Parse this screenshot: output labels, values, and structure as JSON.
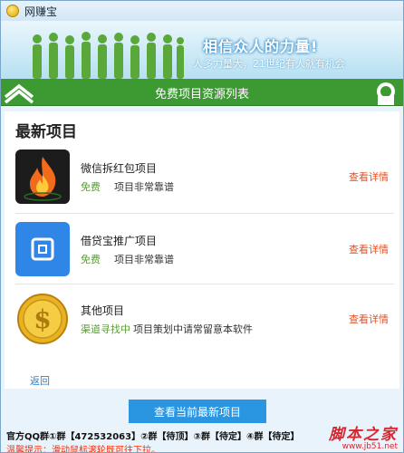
{
  "window": {
    "title": "网赚宝"
  },
  "banner": {
    "slogan": "相信众人的力量!",
    "subslogan": "人多力量大，21世纪有人就有机会"
  },
  "nav": {
    "title": "免费项目资源列表"
  },
  "section": {
    "title": "最新项目"
  },
  "items": [
    {
      "name": "微信拆红包项目",
      "tag": "免费",
      "desc": "项目非常靠谱",
      "link": "查看详情",
      "icon": "flame-icon"
    },
    {
      "name": "借贷宝推广项目",
      "tag": "免费",
      "desc": "项目非常靠谱",
      "link": "查看详情",
      "icon": "jiedaibao-icon"
    },
    {
      "name": "其他项目",
      "tag": "渠道寻找中",
      "desc": "项目策划中请常留意本软件",
      "link": "查看详情",
      "icon": "dollar-coin-icon"
    }
  ],
  "back_label": "返回",
  "main_button": "查看当前最新项目",
  "footer": {
    "groups": "官方QQ群①群【472532063】②群【待顶】③群【待定】④群【待定】",
    "tip": "温馨提示：滑动鼠标滚轮既可往下拉。"
  },
  "watermark": {
    "main": "脚本之家",
    "url": "www.jb51.net"
  },
  "colors": {
    "nav_green": "#3d9a32",
    "link_orange": "#e0522a",
    "button_blue": "#2a95e0",
    "tip_red": "#ff2a00"
  }
}
